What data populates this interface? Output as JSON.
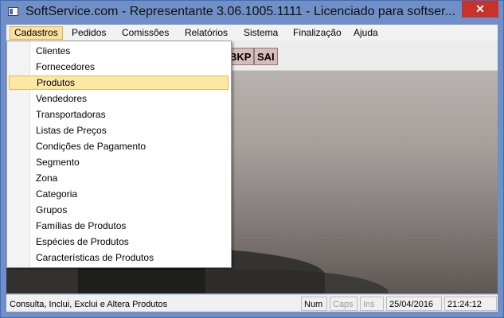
{
  "window": {
    "title": "SoftService.com - Representante 3.06.1005.1111 - Licenciado para softser...",
    "close_label": "✕"
  },
  "menubar": {
    "items": [
      "Cadastros",
      "Pedidos",
      "Comissões",
      "Relatórios",
      "Sistema",
      "Finalização",
      "Ajuda"
    ],
    "active": "Cadastros"
  },
  "toolbar": {
    "buttons": [
      "BKP",
      "SAI"
    ]
  },
  "dropdown": {
    "items": [
      "Clientes",
      "Fornecedores",
      "Produtos",
      "Vendedores",
      "Transportadoras",
      "Listas de Preços",
      "Condições de Pagamento",
      "Segmento",
      "Zona",
      "Categoria",
      "Grupos",
      "Famílias de Produtos",
      "Espécies de Produtos",
      "Características de Produtos"
    ],
    "selected": "Produtos"
  },
  "statusbar": {
    "message": "Consulta, Inclui, Exclui e Altera Produtos",
    "num": "Num",
    "caps": "Caps",
    "ins": "Ins",
    "date": "25/04/2016",
    "time": "21:24:12"
  },
  "colors": {
    "title_bg": "#6f8fc6",
    "close_bg": "#c7322b",
    "selection_bg": "#fde7a5",
    "toolbar_btn": "#d8bcbc"
  }
}
